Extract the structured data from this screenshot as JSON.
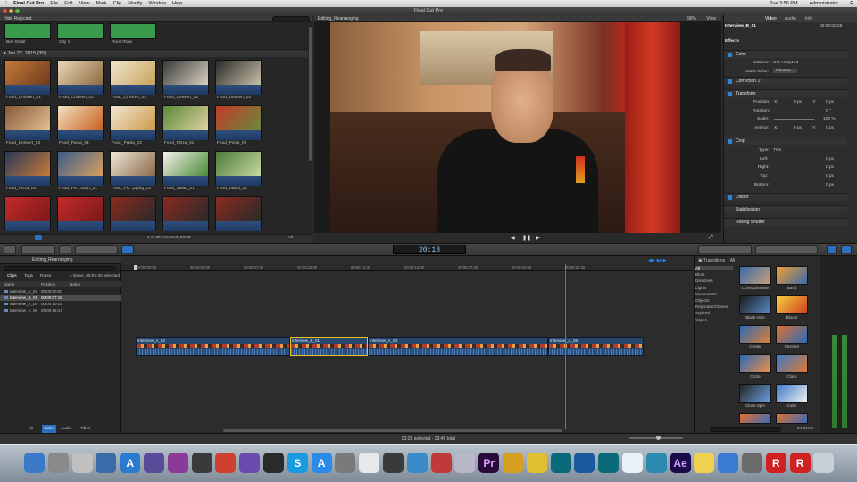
{
  "menubar": {
    "app": "Final Cut Pro",
    "items": [
      "File",
      "Edit",
      "View",
      "Mark",
      "Clip",
      "Modify",
      "Window",
      "Help"
    ],
    "clock": "Tue 3:56 PM",
    "user": "Administrator"
  },
  "window": {
    "title": "Final Cut Pro"
  },
  "browser": {
    "filter": "Hide Rejected",
    "top_row": [
      "Bell Small",
      "City 1",
      "RoomTone"
    ],
    "date_group": "Jan 22, 2015  (30)",
    "clips": [
      "Food_Chicken_01",
      "Food_Chicken_02",
      "Food_Chicken_03",
      "Food_Dessert_01",
      "Food_Dessert_02",
      "Food_Dessert_03",
      "Food_Pasta_01",
      "Food_Pasta_02",
      "Food_Pizza_01",
      "Food_Pizza_02",
      "Food_Pizza_04",
      "Food_Piz...ough_01",
      "Food_Piz...pping_02",
      "Food_Salad_01",
      "Food_Salad_02"
    ],
    "selection": "1 of 30 selected, 03:28",
    "filter_all": "All"
  },
  "viewer": {
    "title": "Editing_Rearranging",
    "zoom": "96%",
    "view": "View"
  },
  "inspector": {
    "tabs": [
      "Video",
      "Audio",
      "Info"
    ],
    "clip_name": "Interview_B_01",
    "clip_time": "00:00:03:28",
    "effects": "Effects",
    "color": "Color",
    "balance_label": "Balance:",
    "balance_value": "Not Analyzed",
    "match_label": "Match Color:",
    "match_value": "Choose...",
    "correction": "Correction 1:",
    "transform": "Transform",
    "position_label": "Position:",
    "position_x": "X:",
    "position_xv": "0 px",
    "position_y": "Y:",
    "position_yv": "0 px",
    "rotation_label": "Rotation:",
    "rotation_value": "0 °",
    "scale_label": "Scale:",
    "scale_value": "100 %",
    "anchor_label": "Anchor:",
    "anchor_x": "X:",
    "anchor_xv": "0 px",
    "anchor_y": "Y:",
    "anchor_yv": "0 px",
    "crop": "Crop",
    "type_label": "Type:",
    "type_value": "Trim",
    "left_label": "Left:",
    "left_value": "0 px",
    "right_label": "Right:",
    "right_value": "0 px",
    "top_label": "Top:",
    "top_value": "0 px",
    "bottom_label": "Bottom:",
    "bottom_value": "0 px",
    "distort": "Distort",
    "stabilization": "Stabilization",
    "rolling_shutter": "Rolling Shutter"
  },
  "toolbar": {
    "timecode": "20:18"
  },
  "timeline_index": {
    "project": "Editing_Rearranging",
    "tabs": [
      "Clips",
      "Tags",
      "Roles"
    ],
    "summary": "4 items, 00:03:28 selected",
    "columns": [
      "Name",
      "Position",
      "Notes"
    ],
    "rows": [
      {
        "name": "Interview_A_02",
        "pos": "00:00:00:00"
      },
      {
        "name": "Interview_B_01",
        "pos": "00:00:07:15"
      },
      {
        "name": "Interview_A_03",
        "pos": "00:00:10:02"
      },
      {
        "name": "Interview_A_08",
        "pos": "00:00:18:17"
      }
    ],
    "bottom_tabs": [
      "All",
      "Video",
      "Audio",
      "Titles"
    ]
  },
  "timeline": {
    "ruler": [
      "00:00:00:00",
      "00:00:05:00",
      "00:00:07:30",
      "00:00:10:00",
      "00:00:12:30",
      "00:00:15:00",
      "00:00:17:30",
      "00:00:20:00",
      "00:00:22:30"
    ],
    "clips": [
      "Interview_A_02",
      "Interview_B_01",
      "Interview_A_03",
      "Interview_A_08"
    ]
  },
  "transitions": {
    "title": "Transitions",
    "all": "All",
    "categories": [
      "All",
      "Blurs",
      "Dissolves",
      "Lights",
      "Movements",
      "Objects",
      "Replicator/Clones",
      "Stylized",
      "Wipes"
    ],
    "items": [
      "Cross Dissolve",
      "Band",
      "Black Hole",
      "Bloom",
      "Center",
      "Checker",
      "Circle",
      "Clock",
      "Close Spin",
      "Cube"
    ],
    "count": "94 Items"
  },
  "status": {
    "text": "03:28 selected - 23:46 total"
  },
  "dock": {
    "icons": [
      "finder-icon",
      "launchpad-icon",
      "preview-icon",
      "iphoto-icon",
      "xcode-icon",
      "imovie-icon",
      "hype-icon",
      "unity-icon",
      "claquette-icon",
      "motion-icon",
      "filmstrip-icon",
      "skype-icon",
      "appstore-icon",
      "automator-icon",
      "textedit-icon",
      "fcp-icon",
      "compressor-icon",
      "davinci-icon",
      "dvd-icon",
      "premiere-icon",
      "sketch-icon",
      "imovie-star-icon",
      "maya-icon",
      "cinema4d-icon",
      "maya2-icon",
      "safari-icon",
      "mudbox-icon",
      "aftereffects-icon",
      "sticky-icon",
      "folder-icon",
      "mosaic-icon",
      "roblox-icon",
      "roblox2-icon",
      "trash-icon"
    ],
    "labels": {
      "premiere": "Pr",
      "aftereffects": "Ae",
      "app": "A",
      "skype": "S"
    }
  }
}
